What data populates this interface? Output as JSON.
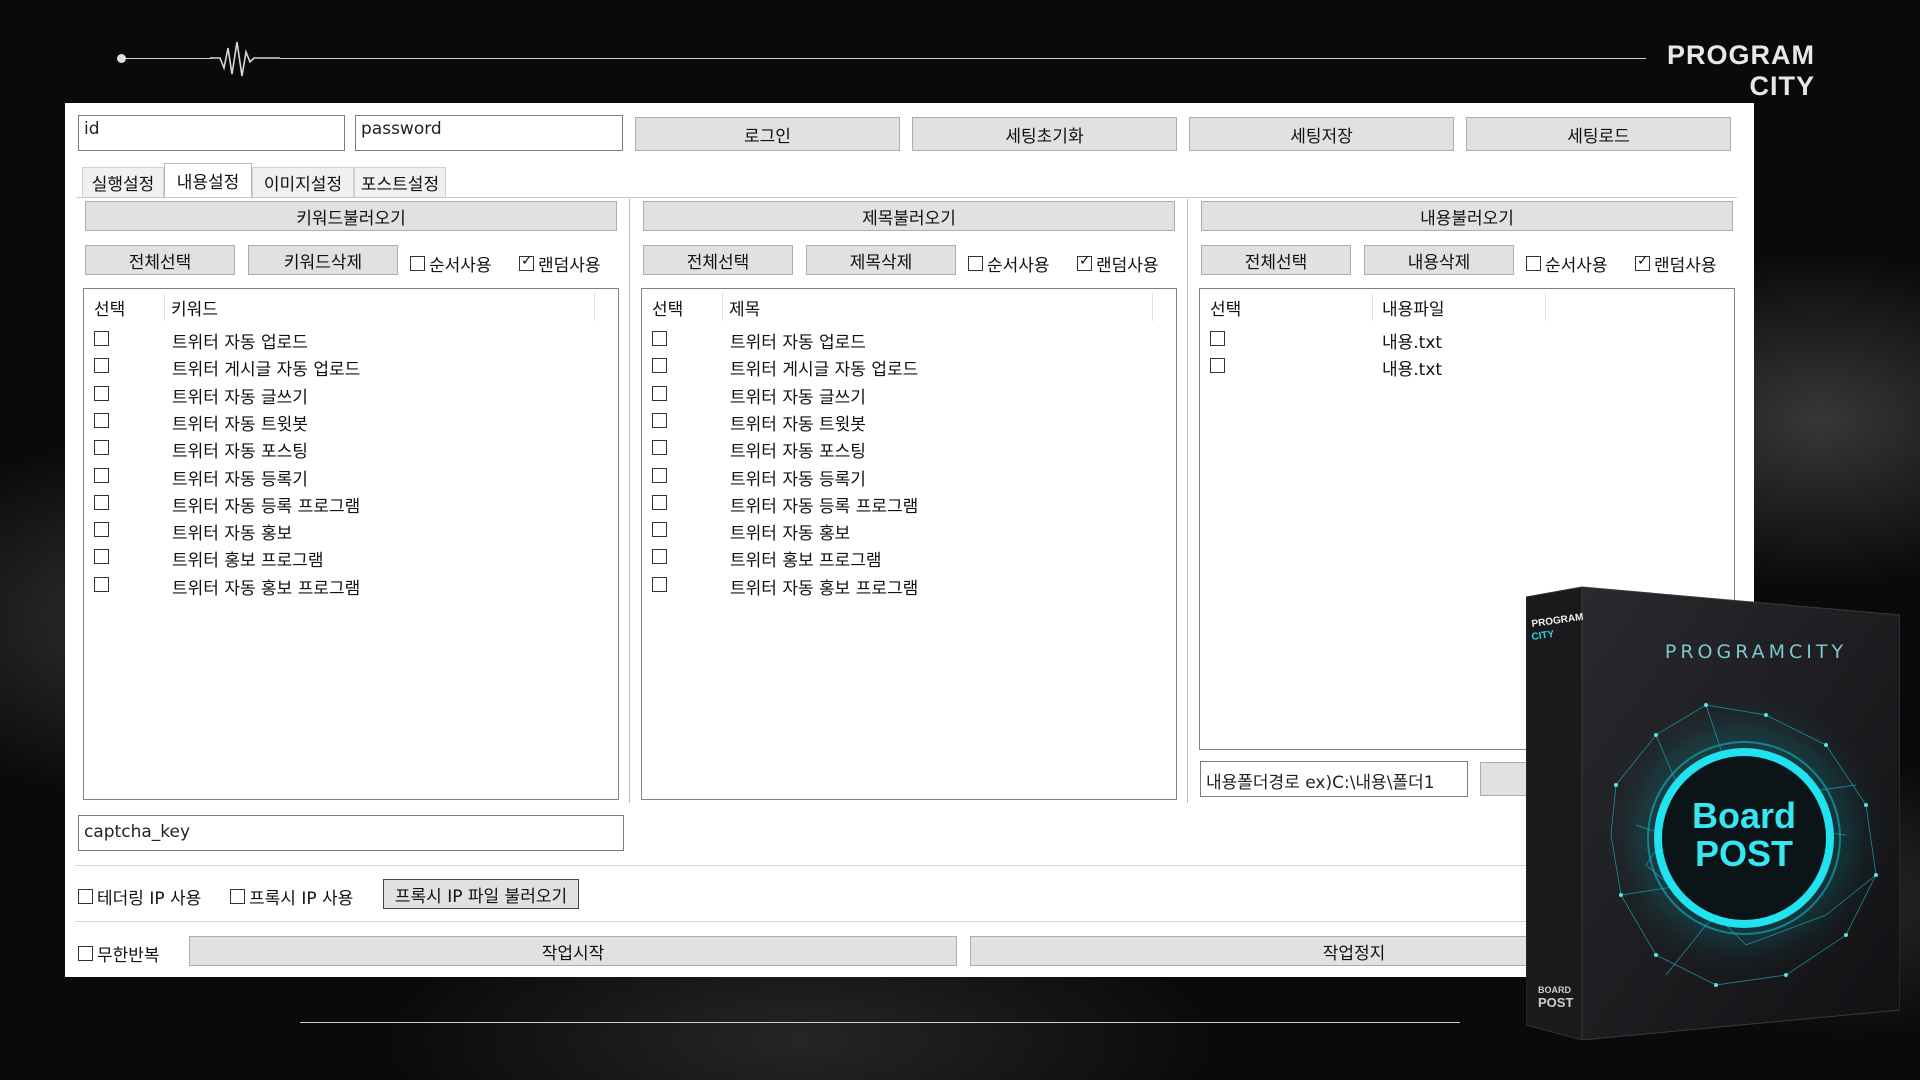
{
  "brand": {
    "line1": "PROGRAM",
    "line2": "CITY"
  },
  "login": {
    "id_value": "id",
    "password_value": "password",
    "login_label": "로그인",
    "reset_label": "세팅초기화",
    "save_label": "세팅저장",
    "load_label": "세팅로드"
  },
  "tabs": [
    "실행설정",
    "내용설정",
    "이미지설정",
    "포스트설정"
  ],
  "keyword_panel": {
    "load_label": "키워드불러오기",
    "select_all_label": "전체선택",
    "delete_label": "키워드삭제",
    "order_label": "순서사용",
    "random_label": "랜덤사용",
    "col_select": "선택",
    "col_name": "키워드",
    "items": [
      "트위터 자동 업로드",
      "트위터 게시글 자동 업로드",
      "트위터 자동 글쓰기",
      "트위터 자동 트윗봇",
      "트위터 자동 포스팅",
      "트위터 자동 등록기",
      "트위터 자동 등록 프로그램",
      "트위터 자동 홍보",
      "트위터 홍보 프로그램",
      "트위터 자동 홍보 프로그램"
    ]
  },
  "title_panel": {
    "load_label": "제목불러오기",
    "select_all_label": "전체선택",
    "delete_label": "제목삭제",
    "order_label": "순서사용",
    "random_label": "랜덤사용",
    "col_select": "선택",
    "col_name": "제목",
    "items": [
      "트위터 자동 업로드",
      "트위터 게시글 자동 업로드",
      "트위터 자동 글쓰기",
      "트위터 자동 트윗봇",
      "트위터 자동 포스팅",
      "트위터 자동 등록기",
      "트위터 자동 등록 프로그램",
      "트위터 자동 홍보",
      "트위터 홍보 프로그램",
      "트위터 자동 홍보 프로그램"
    ]
  },
  "content_panel": {
    "load_label": "내용불러오기",
    "select_all_label": "전체선택",
    "delete_label": "내용삭제",
    "order_label": "순서사용",
    "random_label": "랜덤사용",
    "col_select": "선택",
    "col_name": "내용파일",
    "items": [
      "내용.txt",
      "내용.txt"
    ],
    "folder_value": "내용폴더경로 ex)C:\\내용\\폴더1"
  },
  "captcha_value": "captcha_key",
  "proxy": {
    "tethering_label": "테더링 IP 사용",
    "proxy_label": "프록시 IP 사용",
    "proxy_file_label": "프록시 IP 파일 불러오기"
  },
  "run": {
    "loop_label": "무한반복",
    "start_label": "작업시작",
    "stop_label": "작업정지"
  },
  "product": {
    "small_line1": "PROGRAM",
    "small_line2": "CITY",
    "brand_line": "PROGRAMCITY",
    "title_line1": "Board",
    "title_line2": "POST",
    "spine_line1": "BOARD",
    "spine_line2": "POST"
  },
  "colors": {
    "accent": "#00d8e8",
    "background": "#0a0a0a"
  }
}
